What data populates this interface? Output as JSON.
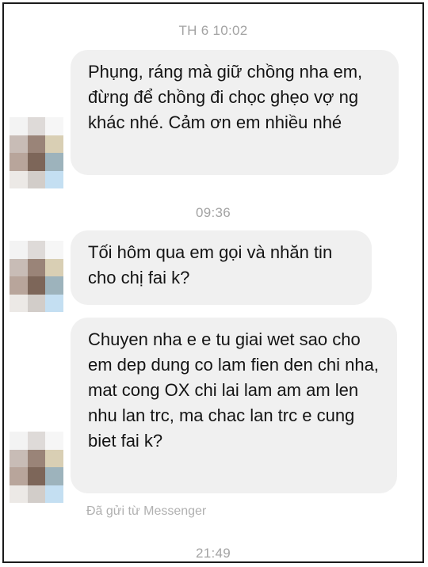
{
  "conversation": {
    "timestamps": [
      "TH 6 10:02",
      "09:36",
      "21:49"
    ],
    "messages": [
      {
        "text": "Phụng, ráng mà giữ chồng nha em, đừng để chồng đi chọc ghẹo vợ ng khác nhé. Cảm ơn em nhiều nhé"
      },
      {
        "text": "Tối hôm qua em gọi và nhăn tin cho chị fai k?"
      },
      {
        "text": "Chuyen nha e e tu giai wet sao cho em dep dung co lam fien den chi nha, mat cong OX chi lai lam am am len nhu lan trc, ma chac lan trc e cung biet fai k?"
      }
    ],
    "sent_from_note": "Đã gửi từ Messenger"
  },
  "avatar": {
    "icon": "pixelated-avatar-icon",
    "colors": [
      "#f3f3f3",
      "#dedad8",
      "#f6f6f6",
      "#c8bcb6",
      "#9a8478",
      "#d9cfb4",
      "#b8a59b",
      "#7d6659",
      "#9db3bc",
      "#ece9e6",
      "#d2cdc9",
      "#c4dff2"
    ]
  },
  "colors": {
    "bubble": "#f0f0f0",
    "timestamp": "#a3a3a3",
    "border": "#1a1a1a"
  }
}
